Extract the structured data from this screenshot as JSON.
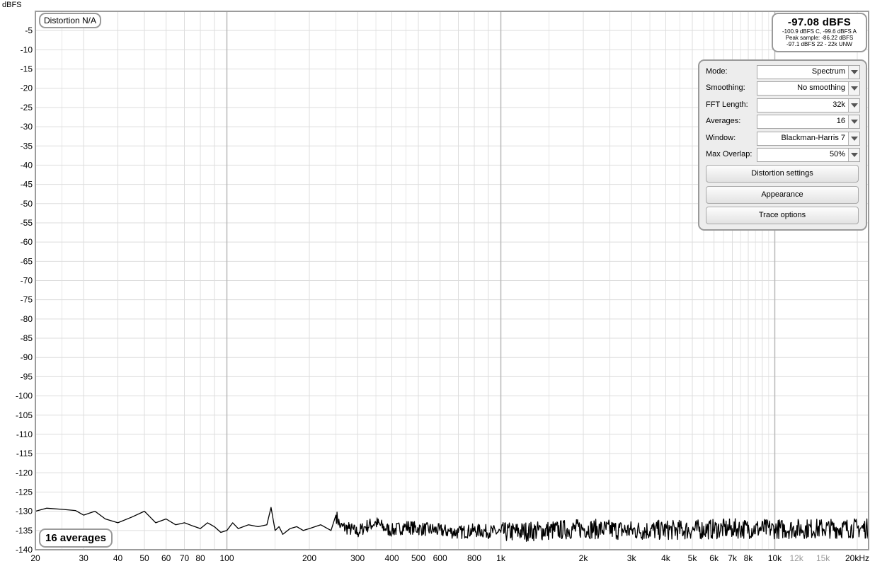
{
  "chart_data": {
    "type": "line",
    "ylabel": "dBFS",
    "xscale": "log",
    "xlim": [
      20,
      22000
    ],
    "ylim": [
      -140,
      0
    ],
    "grid": true,
    "y_ticks": [
      -5,
      -10,
      -15,
      -20,
      -25,
      -30,
      -35,
      -40,
      -45,
      -50,
      -55,
      -60,
      -65,
      -70,
      -75,
      -80,
      -85,
      -90,
      -95,
      -100,
      -105,
      -110,
      -115,
      -120,
      -125,
      -130,
      -135,
      -140
    ],
    "x_ticks": [
      {
        "value": 20,
        "label": "20"
      },
      {
        "value": 30,
        "label": "30"
      },
      {
        "value": 40,
        "label": "40"
      },
      {
        "value": 50,
        "label": "50"
      },
      {
        "value": 60,
        "label": "60"
      },
      {
        "value": 70,
        "label": "70"
      },
      {
        "value": 80,
        "label": "80"
      },
      {
        "value": 100,
        "label": "100"
      },
      {
        "value": 200,
        "label": "200"
      },
      {
        "value": 300,
        "label": "300"
      },
      {
        "value": 400,
        "label": "400"
      },
      {
        "value": 500,
        "label": "500"
      },
      {
        "value": 600,
        "label": "600"
      },
      {
        "value": 800,
        "label": "800"
      },
      {
        "value": 1000,
        "label": "1k"
      },
      {
        "value": 2000,
        "label": "2k"
      },
      {
        "value": 3000,
        "label": "3k"
      },
      {
        "value": 4000,
        "label": "4k"
      },
      {
        "value": 5000,
        "label": "5k"
      },
      {
        "value": 6000,
        "label": "6k"
      },
      {
        "value": 7000,
        "label": "7k"
      },
      {
        "value": 8000,
        "label": "8k"
      },
      {
        "value": 10000,
        "label": "10k"
      },
      {
        "value": 12000,
        "label": "12k",
        "muted": true
      },
      {
        "value": 15000,
        "label": "15k",
        "muted": true
      },
      {
        "value": 20000,
        "label": "20kHz"
      }
    ],
    "series": [
      {
        "color": "#000000",
        "x": [
          20,
          22,
          25,
          28,
          30,
          33,
          36,
          40,
          45,
          50,
          55,
          60,
          65,
          70,
          75,
          80,
          85,
          90,
          95,
          100,
          105,
          110,
          120,
          130,
          140,
          145,
          150,
          155,
          160,
          170,
          180,
          190,
          200,
          220,
          240,
          250,
          260,
          280,
          300,
          320,
          350,
          380,
          400,
          450,
          500,
          600,
          700,
          800,
          1000,
          1500,
          2000,
          3000,
          5000,
          7000,
          10000,
          15000,
          20000,
          22000
        ],
        "y": [
          -130,
          -129.2,
          -129.5,
          -129.8,
          -131,
          -130,
          -132,
          -133,
          -131.5,
          -130,
          -133,
          -132,
          -133.5,
          -133,
          -133.8,
          -134.5,
          -133,
          -134,
          -135.5,
          -135,
          -133,
          -134.5,
          -133.5,
          -134,
          -133.5,
          -129,
          -135,
          -134,
          -136,
          -134.5,
          -134,
          -135,
          -134.5,
          -133.5,
          -135,
          -131,
          -134,
          -134.5,
          -135.5,
          -134,
          -133,
          -134.5,
          -135,
          -134,
          -134.5,
          -135,
          -135.5,
          -135,
          -135.5,
          -135,
          -134.5,
          -135,
          -134.8,
          -134.5,
          -134.6,
          -134.5,
          -134.4,
          -134.5
        ]
      }
    ]
  },
  "badges": {
    "distortion": "Distortion N/A",
    "averages": "16 averages"
  },
  "readout": {
    "main": "-97.08 dBFS",
    "line1": "-100.9 dBFS C, -99.6 dBFS A",
    "line2": "Peak sample: -86.22 dBFS",
    "line3": "-97.1 dBFS 22 - 22k UNW"
  },
  "controls": {
    "mode_label": "Mode:",
    "mode_value": "Spectrum",
    "smoothing_label": "Smoothing:",
    "smoothing_value": "No  smoothing",
    "fft_label": "FFT Length:",
    "fft_value": "32k",
    "averages_label": "Averages:",
    "averages_value": "16",
    "window_label": "Window:",
    "window_value": "Blackman-Harris 7",
    "overlap_label": "Max Overlap:",
    "overlap_value": "50%",
    "distortion_button": "Distortion settings",
    "appearance_button": "Appearance",
    "trace_button": "Trace options"
  },
  "colors": {
    "grid_major": "#b8b8b8",
    "grid_minor": "#dddddd",
    "trace": "#000000",
    "panel": "#ededed"
  }
}
